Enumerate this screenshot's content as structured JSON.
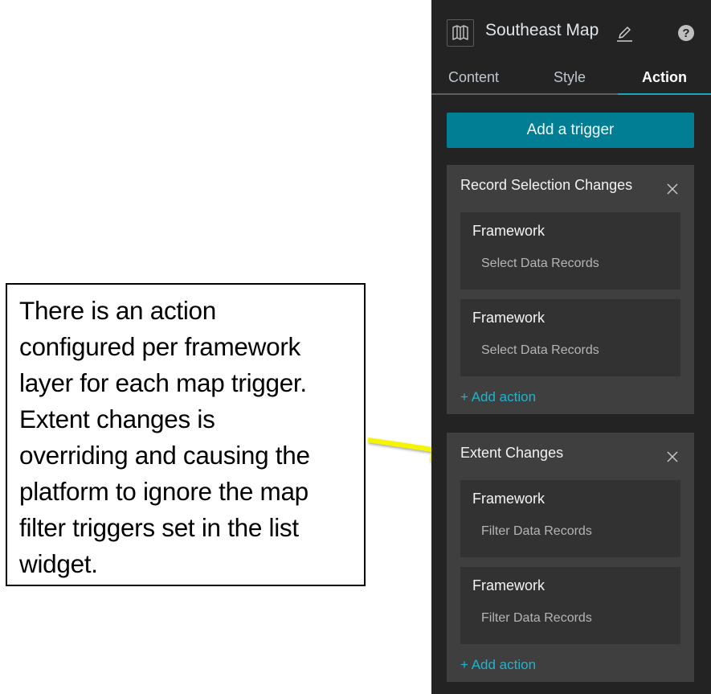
{
  "callout": {
    "lines": [
      "There is an action",
      "configured per framework",
      "layer for each map trigger.",
      "Extent changes is",
      "overriding and causing the",
      "platform to ignore the map",
      "filter triggers set in the list",
      "widget."
    ],
    "arrow_color": "#f5f500"
  },
  "panel": {
    "header": {
      "icon": "map-icon",
      "title": "Southeast Map",
      "edit_icon": "pencil-icon",
      "help_icon": "question-circle-icon",
      "help_glyph": "?"
    },
    "tabs": [
      {
        "label": "Content",
        "active": false
      },
      {
        "label": "Style",
        "active": false
      },
      {
        "label": "Action",
        "active": true
      }
    ],
    "add_trigger_label": "Add a trigger",
    "triggers": [
      {
        "title": "Record Selection Changes",
        "actions": [
          {
            "layer": "Framework",
            "type": "Select Data Records"
          },
          {
            "layer": "Framework",
            "type": "Select Data Records"
          }
        ],
        "add_action_label": "+ Add action"
      },
      {
        "title": "Extent Changes",
        "actions": [
          {
            "layer": "Framework",
            "type": "Filter Data Records"
          },
          {
            "layer": "Framework",
            "type": "Filter Data Records"
          }
        ],
        "add_action_label": "+ Add action"
      }
    ],
    "colors": {
      "accent": "#017e93",
      "link": "#19b6d1",
      "tab_indicator": "#1ba5b9",
      "panel_bg": "#232323",
      "card_bg": "#3f3f3f",
      "action_bg": "#323232"
    }
  }
}
